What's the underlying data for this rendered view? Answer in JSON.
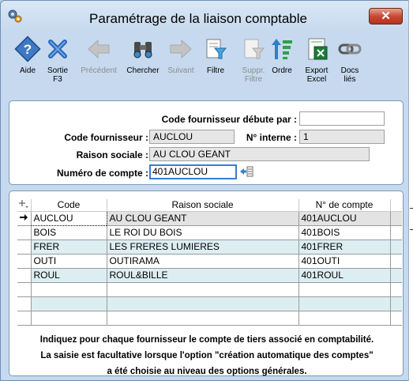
{
  "window": {
    "title": "Paramétrage de la liaison comptable",
    "close_label": "✕"
  },
  "toolbar": [
    {
      "label": "Aide",
      "icon": "help-icon",
      "enabled": true
    },
    {
      "label": "Sortie F3",
      "icon": "exit-icon",
      "enabled": true
    },
    {
      "label": "Précédent",
      "icon": "arrow-left-icon",
      "enabled": false
    },
    {
      "label": "Chercher",
      "icon": "binoculars-icon",
      "enabled": true
    },
    {
      "label": "Suivant",
      "icon": "arrow-right-icon",
      "enabled": false
    },
    {
      "label": "Filtre",
      "icon": "filter-icon",
      "enabled": true
    },
    {
      "label": "Suppr. Filtre",
      "icon": "remove-filter-icon",
      "enabled": false
    },
    {
      "label": "Ordre",
      "icon": "sort-icon",
      "enabled": true
    },
    {
      "label": "Export Excel",
      "icon": "excel-icon",
      "enabled": true
    },
    {
      "label": "Docs liés",
      "icon": "linked-docs-icon",
      "enabled": true
    }
  ],
  "form": {
    "starts_with_label": "Code fournisseur débute par :",
    "starts_with_value": "",
    "supplier_code_label": "Code fournisseur :",
    "supplier_code_value": "AUCLOU",
    "internal_no_label": "N° interne :",
    "internal_no_value": "1",
    "company_name_label": "Raison sociale :",
    "company_name_value": "AU CLOU GEANT",
    "account_label": "Numéro de compte :",
    "account_value": "401AUCLOU"
  },
  "grid": {
    "columns": [
      "Code",
      "Raison sociale",
      "N° de compte"
    ],
    "rows": [
      {
        "code": "AUCLOU",
        "name": "AU CLOU GEANT",
        "account": "401AUCLOU",
        "selected": true
      },
      {
        "code": "BOIS",
        "name": "LE ROI DU BOIS",
        "account": "401BOIS",
        "selected": false
      },
      {
        "code": "FRER",
        "name": "LES FRERES LUMIERES",
        "account": "401FRER",
        "selected": false
      },
      {
        "code": "OUTI",
        "name": "OUTIRAMA",
        "account": "401OUTI",
        "selected": false
      },
      {
        "code": "ROUL",
        "name": "ROUL&BILLE",
        "account": "401ROUL",
        "selected": false
      },
      {
        "code": "",
        "name": "",
        "account": "",
        "selected": false
      },
      {
        "code": "",
        "name": "",
        "account": "",
        "selected": false
      },
      {
        "code": "",
        "name": "",
        "account": "",
        "selected": false
      }
    ]
  },
  "footnote": {
    "line1": "Indiquez pour chaque fournisseur le compte de tiers associé en comptabilité.",
    "line2": "La saisie est facultative lorsque l'option \"création automatique des comptes\"",
    "line3": "a été choisie au niveau des options générales."
  },
  "colors": {
    "window_bg": "#c6d9ee",
    "close_red": "#c74a35",
    "alt_row": "#ddeef3",
    "focus_border": "#3a7bd5"
  }
}
